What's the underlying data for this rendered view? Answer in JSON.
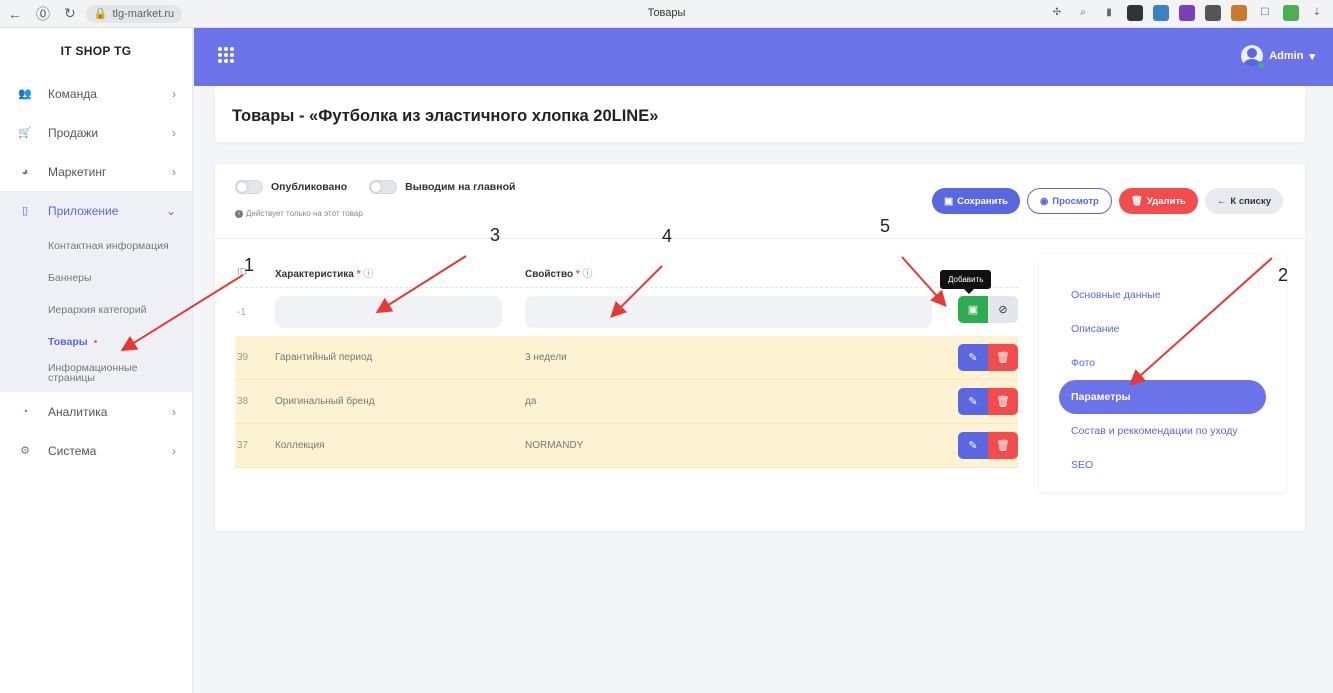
{
  "browser": {
    "url": "tlg-market.ru",
    "tab_title": "Товары"
  },
  "sidebar": {
    "brand": "IT SHOP TG",
    "items": [
      {
        "label": "Команда",
        "icon": "team-icon"
      },
      {
        "label": "Продажи",
        "icon": "cart-icon"
      },
      {
        "label": "Маркетинг",
        "icon": "marketing-icon"
      },
      {
        "label": "Приложение",
        "icon": "mobile-icon"
      },
      {
        "label": "Аналитика",
        "icon": "chart-icon"
      },
      {
        "label": "Система",
        "icon": "gears-icon"
      }
    ],
    "subitems": [
      "Контактная информация",
      "Баннеры",
      "Иерархия категорий",
      "Товары",
      "Информационные страницы"
    ]
  },
  "topbar": {
    "user": "Admin"
  },
  "page": {
    "title": "Товары - «Футболка из эластичного хлопка 20LINE»"
  },
  "toggles": {
    "published": "Опубликовано",
    "on_main": "Выводим на главной",
    "hint": "Действует только на этот товар"
  },
  "actions": {
    "save": "Сохранить",
    "view": "Просмотр",
    "delete": "Удалить",
    "back": "К списку"
  },
  "table": {
    "headers": {
      "id": "ID",
      "characteristic": "Характеристика",
      "property": "Свойство",
      "required_mark": "*"
    },
    "new_row_id": "-1",
    "tooltip": "Добавить",
    "rows": [
      {
        "id": "39",
        "characteristic": "Гарантийный период",
        "property": "3 недели"
      },
      {
        "id": "38",
        "characteristic": "Оригинальный бренд",
        "property": "да"
      },
      {
        "id": "37",
        "characteristic": "Коллекция",
        "property": "NORMANDY"
      }
    ]
  },
  "tabs": [
    "Основные данные",
    "Описание",
    "Фото",
    "Параметры",
    "Состав и реккомендации по уходу",
    "SEO"
  ],
  "annotations": {
    "n1": "1",
    "n2": "2",
    "n3": "3",
    "n4": "4",
    "n5": "5"
  },
  "colors": {
    "accent": "#6a73e8",
    "danger": "#f24c4c",
    "success": "#2dad4f",
    "row_highlight": "#fdf3d2",
    "arrow": "#e53935"
  }
}
